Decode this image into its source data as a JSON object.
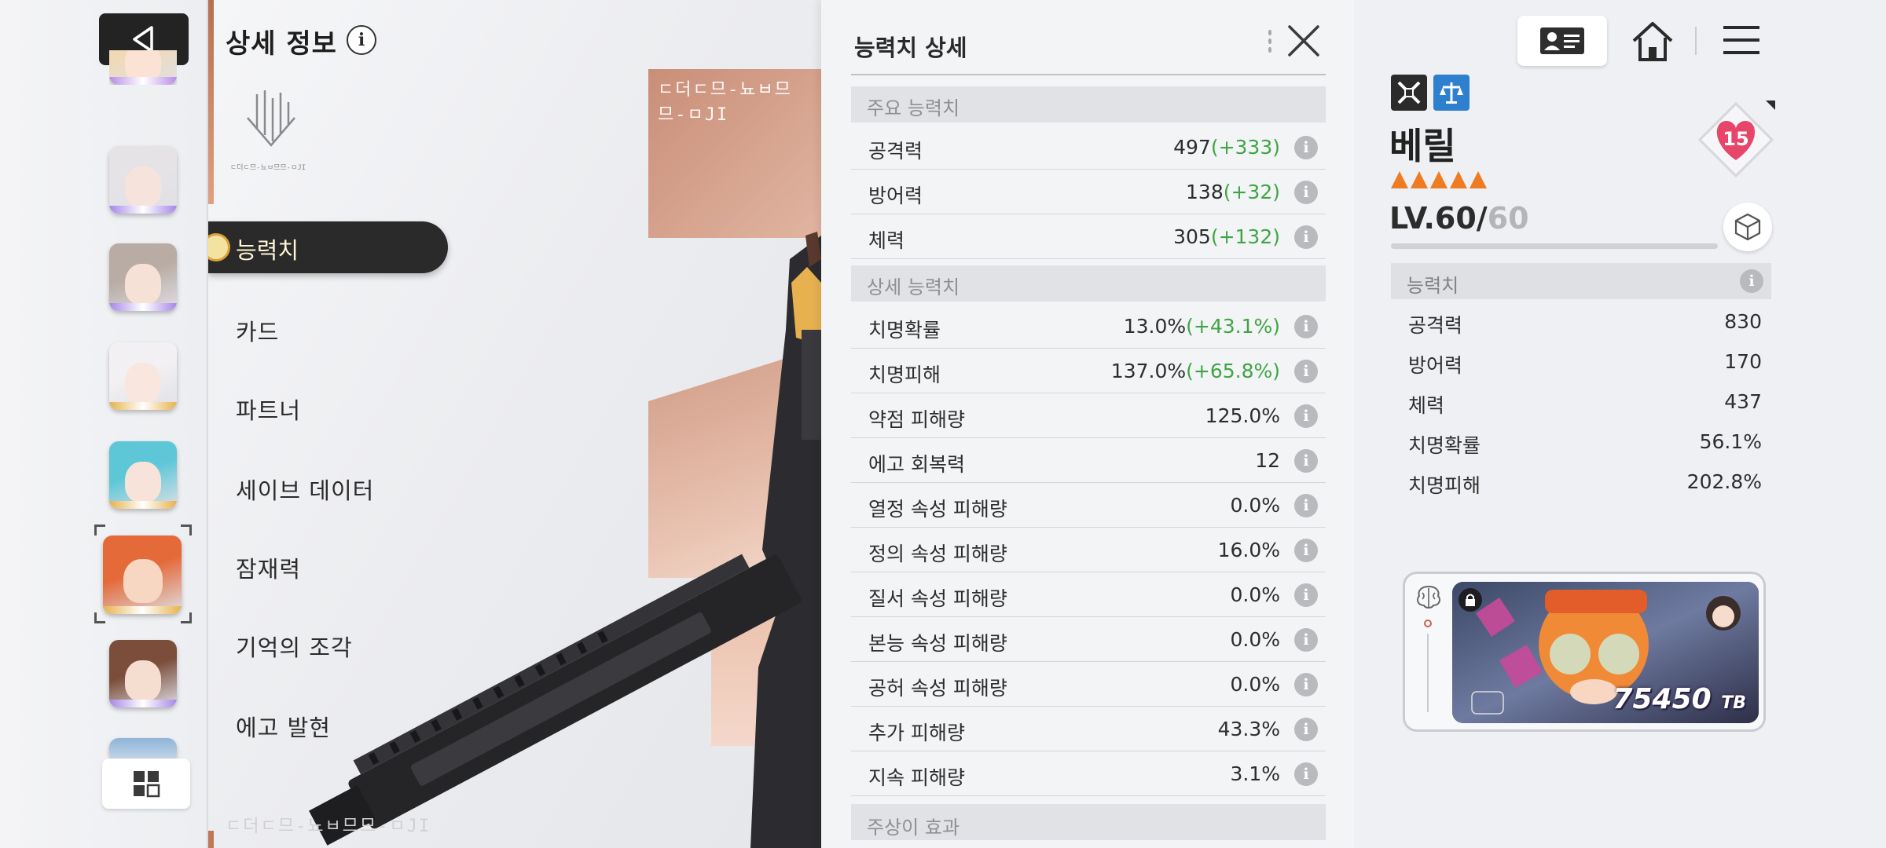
{
  "left_strip": {
    "portraits": [
      {
        "name": "portrait-1",
        "hair": "#f0d9b6",
        "skin": "#fae3d4",
        "glow": "#b78ce6"
      },
      {
        "name": "portrait-2",
        "hair": "#e6e3e6",
        "skin": "#f6e4dc",
        "glow": "#a686e8"
      },
      {
        "name": "portrait-3",
        "hair": "#b9aca4",
        "skin": "#f5e1d6",
        "glow": "#a686e8"
      },
      {
        "name": "portrait-4",
        "hair": "#f2f0f2",
        "skin": "#f8e6df",
        "glow": "#e7b24b"
      },
      {
        "name": "portrait-5",
        "hair": "#5dc7d8",
        "skin": "#f7e3d9",
        "glow": "#e7b24b"
      },
      {
        "name": "portrait-6-selected",
        "hair": "#e46a3a",
        "skin": "#f7d6c2",
        "glow": "#e7b24b"
      },
      {
        "name": "portrait-7",
        "hair": "#7a4e3b",
        "skin": "#f5ddd0",
        "glow": "#a686e8"
      }
    ]
  },
  "nav": {
    "title": "상세 정보",
    "info_glyph": "i",
    "items": [
      "능력치",
      "카드",
      "파트너",
      "세이브 데이터",
      "잠재력",
      "기억의 조각",
      "에고 발현"
    ],
    "active_index": 0,
    "banner_text": "ㄷ더ㄷ므-뇨ㅂ므므-ㅁJI",
    "logo_caption": "ㄷ더ㄷ므-뇨ㅂ므므-ㅁJI"
  },
  "detail": {
    "title": "능력치 상세",
    "main_section": "주요 능력치",
    "main_stats": [
      {
        "name": "공격력",
        "value": "497",
        "bonus": "(+333)"
      },
      {
        "name": "방어력",
        "value": "138",
        "bonus": "(+32)"
      },
      {
        "name": "체력",
        "value": "305",
        "bonus": "(+132)"
      }
    ],
    "detail_section": "상세 능력치",
    "detail_stats": [
      {
        "name": "치명확률",
        "value": "13.0%",
        "bonus": "(+43.1%)"
      },
      {
        "name": "치명피해",
        "value": "137.0%",
        "bonus": "(+65.8%)"
      },
      {
        "name": "약점 피해량",
        "value": "125.0%",
        "bonus": ""
      },
      {
        "name": "에고 회복력",
        "value": "12",
        "bonus": ""
      },
      {
        "name": "열정 속성 피해량",
        "value": "0.0%",
        "bonus": ""
      },
      {
        "name": "정의 속성 피해량",
        "value": "16.0%",
        "bonus": ""
      },
      {
        "name": "질서 속성 피해량",
        "value": "0.0%",
        "bonus": ""
      },
      {
        "name": "본능 속성 피해량",
        "value": "0.0%",
        "bonus": ""
      },
      {
        "name": "공허 속성 피해량",
        "value": "0.0%",
        "bonus": ""
      },
      {
        "name": "추가 피해량",
        "value": "43.3%",
        "bonus": ""
      },
      {
        "name": "지속 피해량",
        "value": "3.1%",
        "bonus": ""
      }
    ],
    "cut_section": "주상이 효과",
    "info_glyph": "i"
  },
  "character": {
    "name": "베릴",
    "stars": 5,
    "level_label": "LV.60/",
    "level_max": "60",
    "level_progress": 1.0,
    "affection": "15",
    "stats_header": "능력치",
    "stats": [
      {
        "name": "공격력",
        "value": "830"
      },
      {
        "name": "방어력",
        "value": "170"
      },
      {
        "name": "체력",
        "value": "437"
      },
      {
        "name": "치명확률",
        "value": "56.1%"
      },
      {
        "name": "치명피해",
        "value": "202.8%"
      }
    ],
    "memory_score": "75450",
    "memory_unit": "TB"
  },
  "colors": {
    "accent_orange": "#ef7b22",
    "bonus_green": "#3fa544",
    "heart_pink": "#e8456b",
    "dark_button": "#232323",
    "class_blue": "#2f7fcf"
  }
}
